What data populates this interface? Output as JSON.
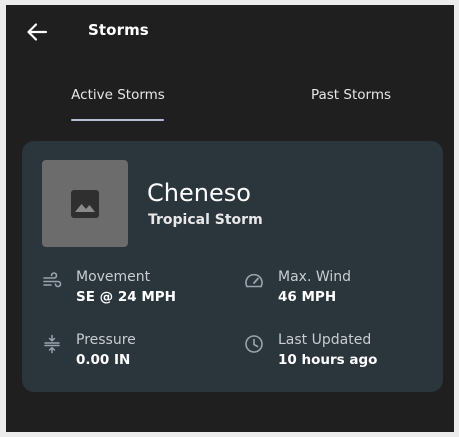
{
  "appbar": {
    "title": "Storms",
    "back_icon": "arrow-back-icon"
  },
  "tabs": [
    {
      "label": "Active Storms",
      "selected": true
    },
    {
      "label": "Past Storms",
      "selected": false
    }
  ],
  "colors": {
    "background": "#1f1f1f",
    "card": "#2b353c",
    "tab_indicator": "#b7bdd2",
    "thumbnail": "#6c6c6c"
  },
  "storm": {
    "image_icon": "image-placeholder-icon",
    "name": "Cheneso",
    "type": "Tropical Storm",
    "stats": {
      "movement": {
        "label": "Movement",
        "value": "SE @ 24 MPH",
        "icon": "wind-icon"
      },
      "max_wind": {
        "label": "Max. Wind",
        "value": "46 MPH",
        "icon": "speedometer-icon"
      },
      "pressure": {
        "label": "Pressure",
        "value": "0.00 IN",
        "icon": "compress-icon"
      },
      "last_updated": {
        "label": "Last Updated",
        "value": "10 hours ago",
        "icon": "clock-icon"
      }
    }
  }
}
